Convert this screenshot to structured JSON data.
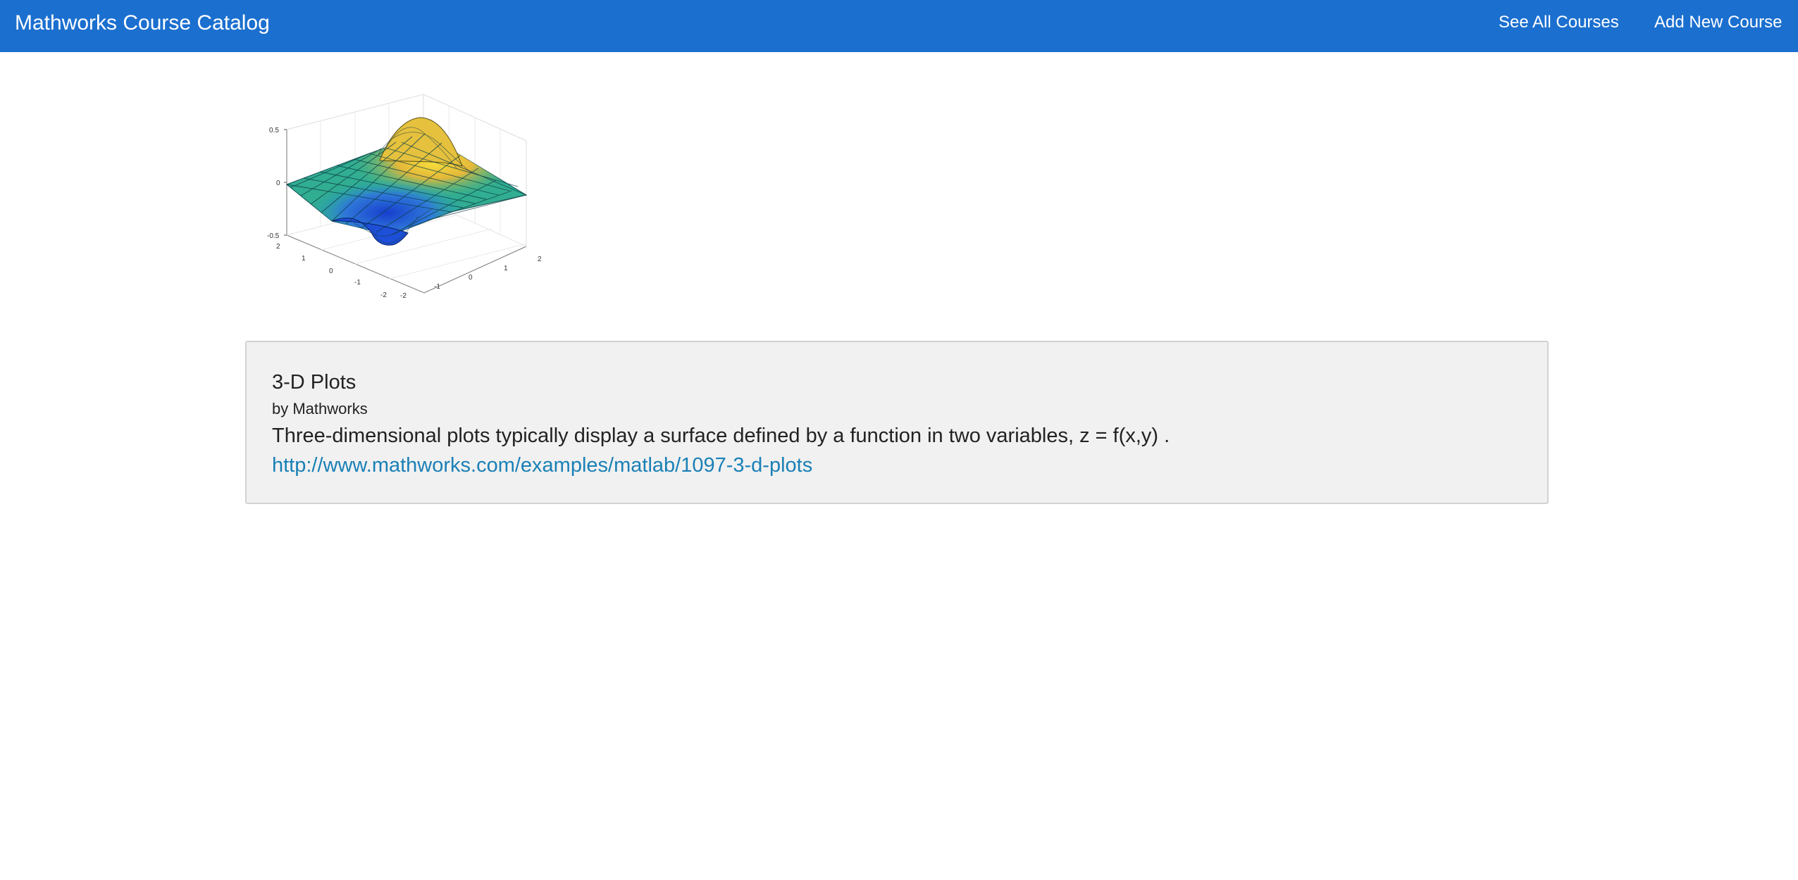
{
  "navbar": {
    "brand": "Mathworks Course Catalog",
    "links": {
      "see_all": "See All Courses",
      "add_new": "Add New Course"
    },
    "background_color": "#1b6fcf"
  },
  "course": {
    "image_icon": "3d-surface-plot-thumbnail",
    "image_tick_labels": {
      "z": [
        "0.5",
        "0",
        "-0.5"
      ],
      "y": [
        "2",
        "1",
        "0",
        "-1",
        "-2"
      ],
      "x": [
        "-2",
        "-1",
        "0",
        "1",
        "2"
      ]
    },
    "title": "3-D Plots",
    "author": "by Mathworks",
    "description": "Three-dimensional plots typically display a surface defined by a function in two variables, z = f(x,y) .",
    "url": "http://www.mathworks.com/examples/matlab/1097-3-d-plots",
    "link_color": "#1a80b6"
  }
}
